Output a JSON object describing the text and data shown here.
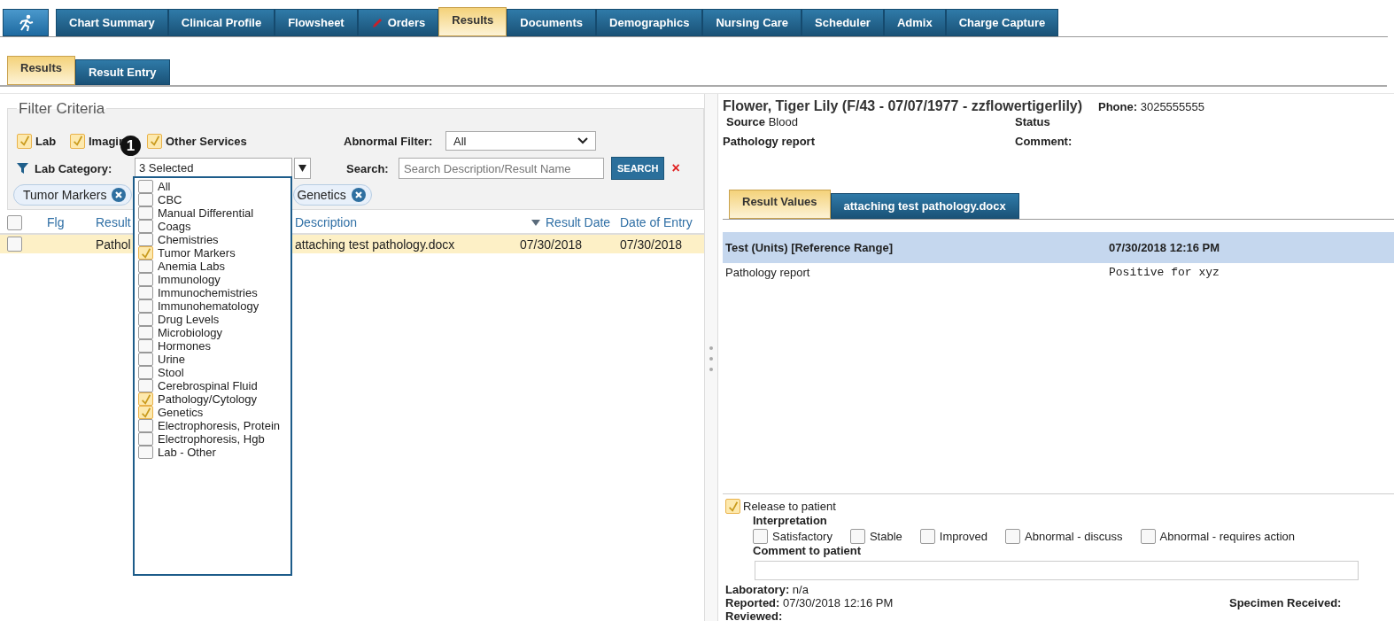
{
  "top_tabs": [
    {
      "kind": "icon",
      "selected": false
    },
    {
      "kind": "text",
      "label": "Chart Summary",
      "selected": false
    },
    {
      "kind": "text",
      "label": "Clinical Profile",
      "selected": false
    },
    {
      "kind": "text",
      "label": "Flowsheet",
      "selected": false
    },
    {
      "kind": "pencil",
      "label": "Orders",
      "selected": false
    },
    {
      "kind": "text",
      "label": "Results",
      "selected": true
    },
    {
      "kind": "text",
      "label": "Documents",
      "selected": false
    },
    {
      "kind": "text",
      "label": "Demographics",
      "selected": false
    },
    {
      "kind": "text",
      "label": "Nursing Care",
      "selected": false
    },
    {
      "kind": "text",
      "label": "Scheduler",
      "selected": false
    },
    {
      "kind": "text",
      "label": "Admix",
      "selected": false
    },
    {
      "kind": "text",
      "label": "Charge Capture",
      "selected": false
    }
  ],
  "sub_tabs": [
    {
      "label": "Results",
      "selected": true
    },
    {
      "label": "Result Entry",
      "selected": false
    }
  ],
  "filter": {
    "title": "Filter Criteria",
    "services": [
      {
        "label": "Lab",
        "checked": true
      },
      {
        "label": "Imagin",
        "checked": true
      },
      {
        "label": "Other Services",
        "checked": true
      }
    ],
    "abnormal_filter": {
      "label": "Abnormal Filter:",
      "value": "All"
    },
    "lab_category": {
      "label": "Lab Category:",
      "value": "3 Selected",
      "expanded": true,
      "options": [
        {
          "label": "All",
          "checked": false
        },
        {
          "label": "CBC",
          "checked": false
        },
        {
          "label": "Manual Differential",
          "checked": false
        },
        {
          "label": "Coags",
          "checked": false
        },
        {
          "label": "Chemistries",
          "checked": false
        },
        {
          "label": "Tumor Markers",
          "checked": true
        },
        {
          "label": "Anemia Labs",
          "checked": false
        },
        {
          "label": "Immunology",
          "checked": false
        },
        {
          "label": "Immunochemistries",
          "checked": false
        },
        {
          "label": "Immunohematology",
          "checked": false
        },
        {
          "label": "Drug Levels",
          "checked": false
        },
        {
          "label": "Microbiology",
          "checked": false
        },
        {
          "label": "Hormones",
          "checked": false
        },
        {
          "label": "Urine",
          "checked": false
        },
        {
          "label": "Stool",
          "checked": false
        },
        {
          "label": "Cerebrospinal Fluid",
          "checked": false
        },
        {
          "label": "Pathology/Cytology",
          "checked": true
        },
        {
          "label": "Genetics",
          "checked": true
        },
        {
          "label": "Electrophoresis, Protein",
          "checked": false
        },
        {
          "label": "Electrophoresis, Hgb",
          "checked": false
        },
        {
          "label": "Lab - Other",
          "checked": false
        }
      ]
    },
    "search": {
      "label": "Search:",
      "placeholder": "Search Description/Result Name",
      "button": "SEARCH",
      "clear": "×"
    },
    "chips": [
      {
        "label": "Tumor Markers"
      },
      {
        "label": "Genetics"
      }
    ]
  },
  "callout_badge": "1",
  "table": {
    "columns": [
      {
        "label": "Flg",
        "sorted": false
      },
      {
        "label": "Result",
        "sorted": false
      },
      {
        "label": "Description",
        "sorted": false
      },
      {
        "label": "Result Date",
        "sorted": true
      },
      {
        "label": "Date of Entry",
        "sorted": false
      }
    ],
    "select_all_checked": false,
    "rows": [
      {
        "checked": false,
        "selected": true,
        "result": "Pathol",
        "description": "attaching test pathology.docx",
        "result_date": "07/30/2018",
        "date_of_entry": "07/30/2018"
      }
    ]
  },
  "detail": {
    "patient": "Flower, Tiger Lily (F/43 - 07/07/1977 - zzflowertigerlily)",
    "phone_label": "Phone:",
    "phone": "3025555555",
    "source_label": "Source",
    "source": "Blood",
    "status_label": "Status",
    "report_name": "Pathology report",
    "comment_label": "Comment:",
    "tabs": [
      {
        "label": "Result Values",
        "selected": true
      },
      {
        "label": "attaching test pathology.docx",
        "selected": false
      }
    ],
    "values_header": {
      "test": "Test (Units) [Reference Range]",
      "date": "07/30/2018 12:16 PM"
    },
    "values": [
      {
        "test": "Pathology report",
        "value": "Positive for xyz"
      }
    ],
    "release": {
      "label": "Release to patient",
      "checked": true
    },
    "interpretation": {
      "title": "Interpretation",
      "options": [
        {
          "label": "Satisfactory",
          "checked": false
        },
        {
          "label": "Stable",
          "checked": false
        },
        {
          "label": "Improved",
          "checked": false
        },
        {
          "label": "Abnormal - discuss",
          "checked": false
        },
        {
          "label": "Abnormal - requires action",
          "checked": false
        }
      ]
    },
    "comment_to_patient": {
      "label": "Comment to patient"
    },
    "laboratory_label": "Laboratory:",
    "laboratory": "n/a",
    "reported_label": "Reported:",
    "reported": "07/30/2018 12:16 PM",
    "reviewed_label": "Reviewed:",
    "specimen_label": "Specimen Received:"
  }
}
